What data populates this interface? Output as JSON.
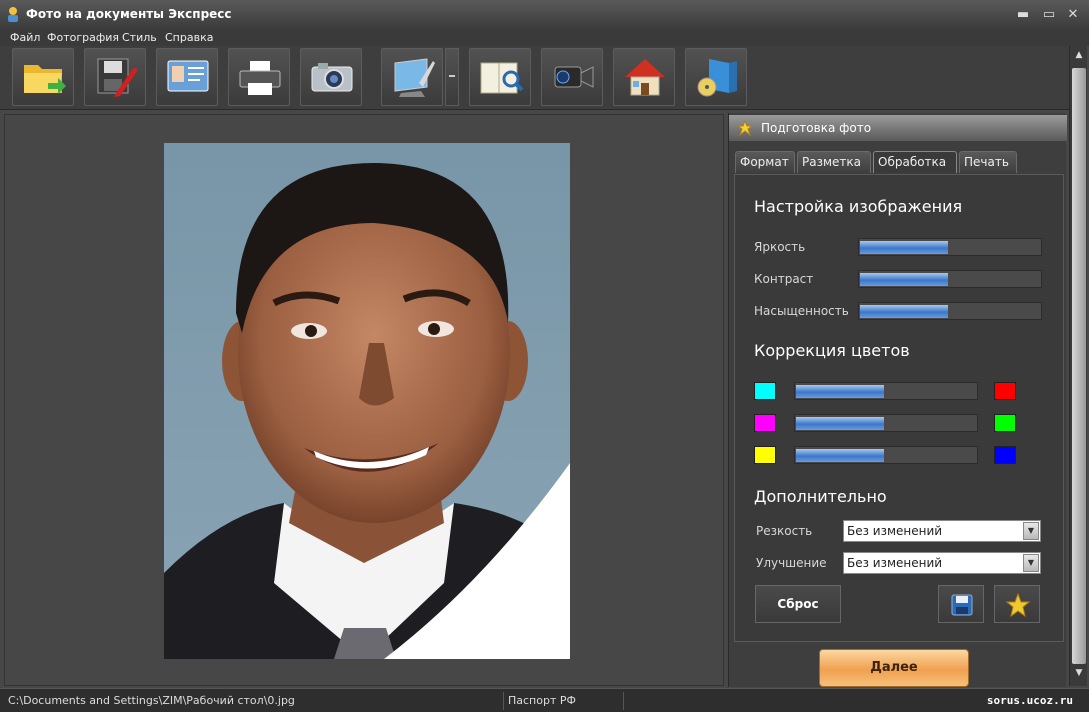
{
  "window": {
    "title": "Фото на документы Экспресс",
    "minimize": "▬",
    "restore": "▭",
    "close": "✕"
  },
  "menu": [
    "Файл",
    "Фотография",
    "Стиль",
    "Справка"
  ],
  "toolbar": {
    "icons": [
      "open-folder-icon",
      "save-edit-icon",
      "id-card-icon",
      "printer-icon",
      "camera-icon",
      "monitor-icon",
      "book-search-icon",
      "video-camera-icon",
      "home-icon",
      "disc-box-icon"
    ]
  },
  "panel": {
    "header": "Подготовка фото",
    "tabs": [
      "Формат",
      "Разметка",
      "Обработка",
      "Печать"
    ],
    "active_tab": "Обработка",
    "image_settings": {
      "title": "Настройка изображения",
      "rows": [
        {
          "label": "Яркость",
          "level": 0.49
        },
        {
          "label": "Контраст",
          "level": 0.49
        },
        {
          "label": "Насыщенность",
          "level": 0.49
        }
      ]
    },
    "color_correction": {
      "title": "Коррекция цветов",
      "rows": [
        {
          "left": "#00ffff",
          "right": "#ff0000",
          "level": 0.49
        },
        {
          "left": "#ff00ff",
          "right": "#00ff00",
          "level": 0.49
        },
        {
          "left": "#ffff00",
          "right": "#0000ff",
          "level": 0.49
        }
      ]
    },
    "extra": {
      "title": "Дополнительно",
      "sharpness_label": "Резкость",
      "sharpness_value": "Без изменений",
      "enhance_label": "Улучшение",
      "enhance_value": "Без изменений"
    },
    "reset_button": "Сброс",
    "next_button": "Далее"
  },
  "status": {
    "path": "C:\\Documents and Settings\\ZIM\\Рабочий стол\\0.jpg",
    "format": "Паспорт РФ",
    "watermark": "sorus.ucoz.ru"
  },
  "colors": {
    "accent": "#3a78c8",
    "next_button": "#f0a050"
  }
}
